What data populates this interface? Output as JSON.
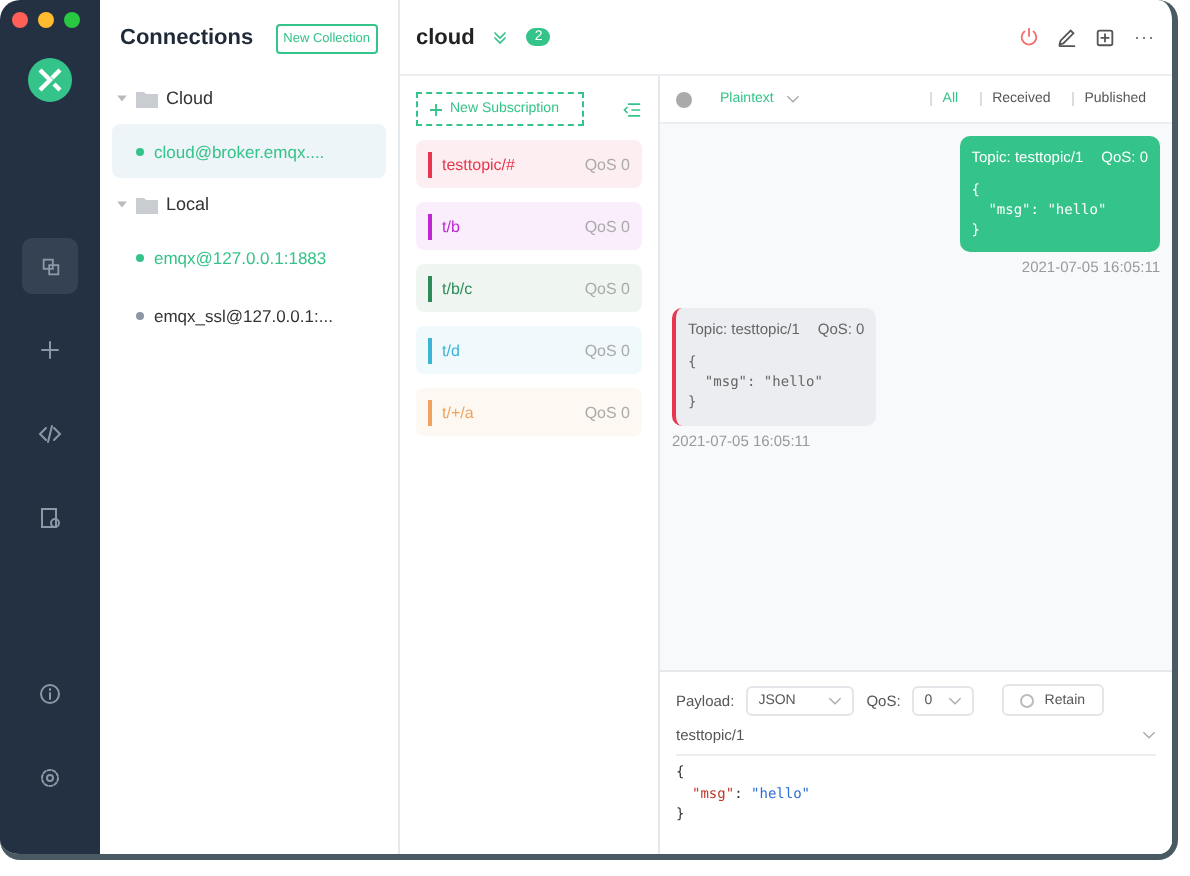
{
  "connections": {
    "title": "Connections",
    "new_button": "New Collection",
    "groups": [
      {
        "name": "Cloud",
        "expanded": true,
        "items": [
          {
            "name": "cloud@broker.emqx....",
            "selected": true,
            "color": "#34c388"
          }
        ]
      },
      {
        "name": "Local",
        "expanded": true,
        "items": [
          {
            "name": "emqx@127.0.0.1:1883",
            "selected": false,
            "color": "#34c388"
          },
          {
            "name": "emqx_ssl@127.0.0.1:...",
            "selected": false,
            "color": "#8e96a3"
          }
        ]
      }
    ]
  },
  "header": {
    "title": "cloud",
    "count": "2"
  },
  "subscriptions": {
    "new_button": "New Subscription",
    "items": [
      {
        "topic": "testtopic/#",
        "qos": "QoS 0",
        "color": "#e8364f"
      },
      {
        "topic": "t/b",
        "qos": "QoS 0",
        "color": "#c026d3"
      },
      {
        "topic": "t/b/c",
        "qos": "QoS 0",
        "color": "#2e8b57"
      },
      {
        "topic": "t/d",
        "qos": "QoS 0",
        "color": "#3bb5d6"
      },
      {
        "topic": "t/+/a",
        "qos": "QoS 0",
        "color": "#f0a35e"
      }
    ]
  },
  "filter": {
    "format": "Plaintext",
    "tabs": [
      {
        "label": "All",
        "selected": true
      },
      {
        "label": "Received",
        "selected": false
      },
      {
        "label": "Published",
        "selected": false
      }
    ]
  },
  "messages": [
    {
      "kind": "sent",
      "topic": "Topic: testtopic/1",
      "qos": "QoS: 0",
      "body": [
        "{",
        "  \"msg\": \"hello\"",
        "}"
      ],
      "time": "2021-07-05 16:05:11"
    },
    {
      "kind": "received",
      "topic": "Topic: testtopic/1",
      "qos": "QoS: 0",
      "body": [
        "{",
        "  \"msg\": \"hello\"",
        "}"
      ],
      "time": "2021-07-05 16:05:11",
      "color": "#e8364f"
    }
  ],
  "publish": {
    "payload_label": "Payload:",
    "payload_type": "JSON",
    "qos_label": "QoS:",
    "qos": "0",
    "retain": {
      "label": "Retain",
      "checked": false
    },
    "topic": "testtopic/1",
    "lines": [
      {
        "kind": "text",
        "text": "{"
      },
      {
        "kind": "pair",
        "key": "\"msg\"",
        "sep": ":",
        "value": "\"hello\""
      },
      {
        "kind": "text",
        "text": "}"
      }
    ]
  }
}
